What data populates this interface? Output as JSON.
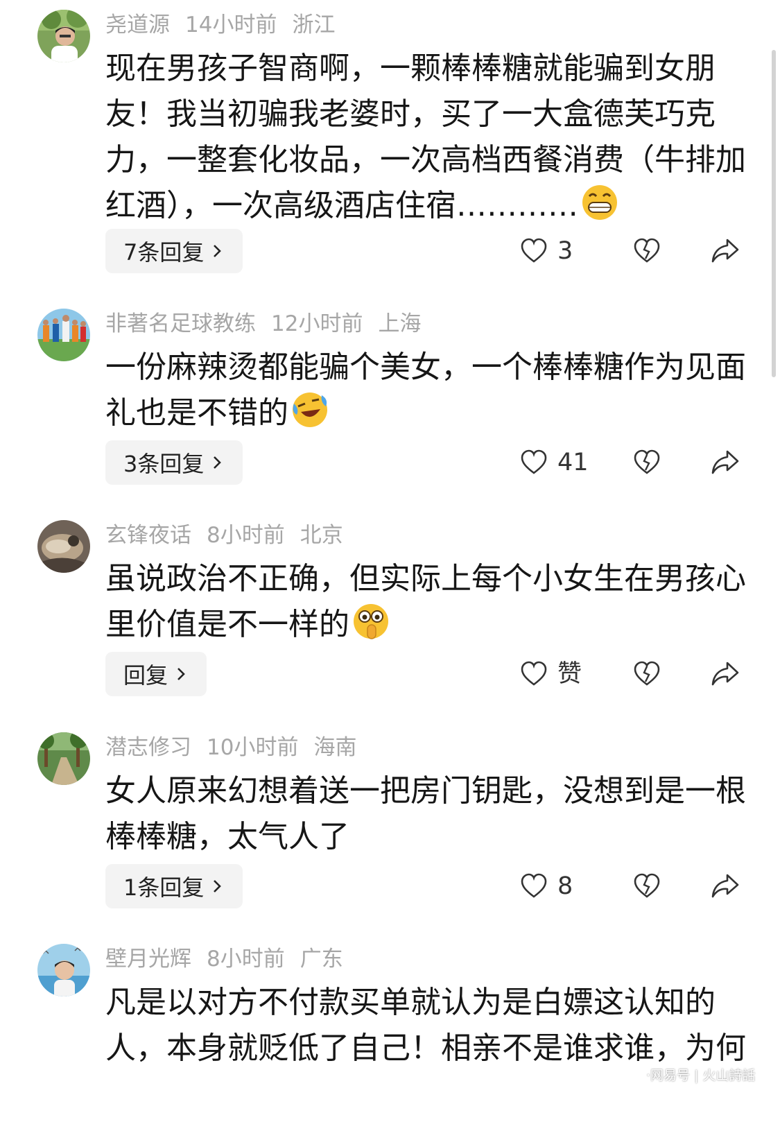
{
  "comments": [
    {
      "username": "尧道源",
      "time": "14小时前",
      "location": "浙江",
      "lines": [
        "现在男孩子智商啊，一颗棒棒糖就能骗到女朋",
        "友！我当初骗我老婆时，买了一大盒德芙巧克",
        "力，一整套化妆品，一次高档西餐消费（牛排加",
        "红酒），一次高级酒店住宿…………"
      ],
      "emoji": "grin-emoji",
      "reply_label": "7条回复",
      "like_count": "3"
    },
    {
      "username": "非著名足球教练",
      "time": "12小时前",
      "location": "上海",
      "lines": [
        "一份麻辣烫都能骗个美女，一个棒棒糖作为见面",
        "礼也是不错的"
      ],
      "emoji": "laugh-cry-emoji",
      "reply_label": "3条回复",
      "like_count": "41"
    },
    {
      "username": "玄锋夜话",
      "time": "8小时前",
      "location": "北京",
      "lines": [
        "虽说政治不正确，但实际上每个小女生在男孩心",
        "里价值是不一样的"
      ],
      "emoji": "shocked-emoji",
      "reply_label": "回复",
      "like_count": "赞"
    },
    {
      "username": "潜志修习",
      "time": "10小时前",
      "location": "海南",
      "lines": [
        "女人原来幻想着送一把房门钥匙，没想到是一根",
        "棒棒糖，太气人了"
      ],
      "emoji": "",
      "reply_label": "1条回复",
      "like_count": "8"
    },
    {
      "username": "壁月光辉",
      "time": "8小时前",
      "location": "广东",
      "lines": [
        "凡是以对方不付款买单就认为是白嫖这认知的",
        "人，本身就贬低了自己！相亲不是谁求谁，为何"
      ],
      "emoji": "",
      "reply_label": "",
      "like_count": ""
    }
  ],
  "watermark": "·网易号 | 火山詩話",
  "colors": {
    "meta": "#a6a6a6",
    "text": "#161616",
    "pill": "#f3f3f3"
  }
}
